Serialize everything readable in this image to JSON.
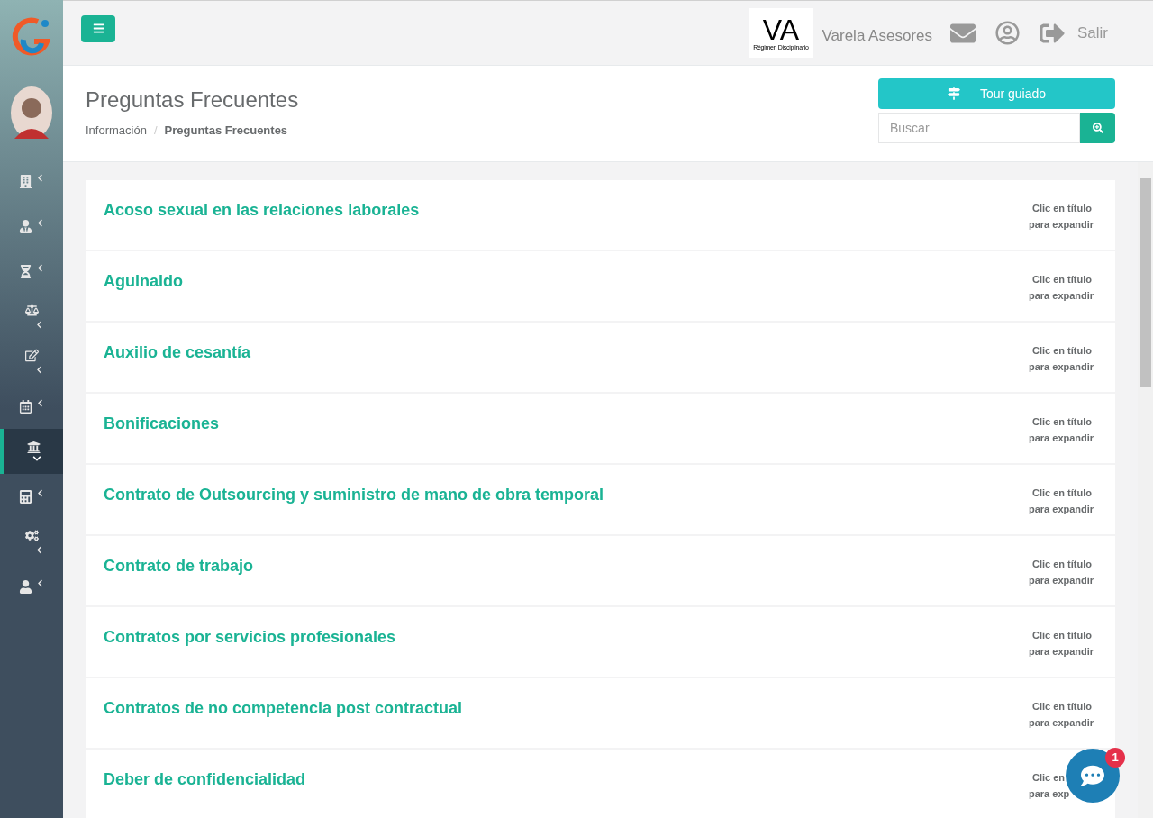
{
  "sidebar": {
    "items": [
      {
        "selected": false
      },
      {
        "selected": false
      },
      {
        "selected": false
      },
      {
        "selected": false
      },
      {
        "selected": false
      },
      {
        "selected": false
      },
      {
        "selected": true
      },
      {
        "selected": false
      },
      {
        "selected": false
      },
      {
        "selected": false
      }
    ]
  },
  "topbar": {
    "logo_big": "VA",
    "logo_small": "Régimen Disciplinario",
    "company": "Varela Asesores",
    "logout": "Salir"
  },
  "header": {
    "title": "Preguntas Frecuentes",
    "breadcrumb": [
      {
        "label": "Información",
        "current": false
      },
      {
        "label": "Preguntas Frecuentes",
        "current": true
      }
    ],
    "breadcrumb_separator": "/",
    "tour_button": "Tour guiado",
    "search": {
      "placeholder": "Buscar"
    }
  },
  "faq": [
    {
      "title": "Acoso sexual en las relaciones laborales",
      "hint": [
        "Clic en título",
        "para expandir"
      ]
    },
    {
      "title": "Aguinaldo",
      "hint": [
        "Clic en título",
        "para expandir"
      ]
    },
    {
      "title": "Auxilio de cesantía",
      "hint": [
        "Clic en título",
        "para expandir"
      ]
    },
    {
      "title": "Bonificaciones",
      "hint": [
        "Clic en título",
        "para expandir"
      ]
    },
    {
      "title": "Contrato de Outsourcing y suministro de mano de obra temporal",
      "hint": [
        "Clic en título",
        "para expandir"
      ]
    },
    {
      "title": "Contrato de trabajo",
      "hint": [
        "Clic en título",
        "para expandir"
      ]
    },
    {
      "title": "Contratos por servicios profesionales",
      "hint": [
        "Clic en título",
        "para expandir"
      ]
    },
    {
      "title": "Contratos de no competencia post contractual",
      "hint": [
        "Clic en título",
        "para expandir"
      ]
    },
    {
      "title": "Deber de confidencialidad",
      "hint": [
        "Clic en",
        "para exp"
      ]
    }
  ],
  "chat": {
    "badge": "1"
  }
}
